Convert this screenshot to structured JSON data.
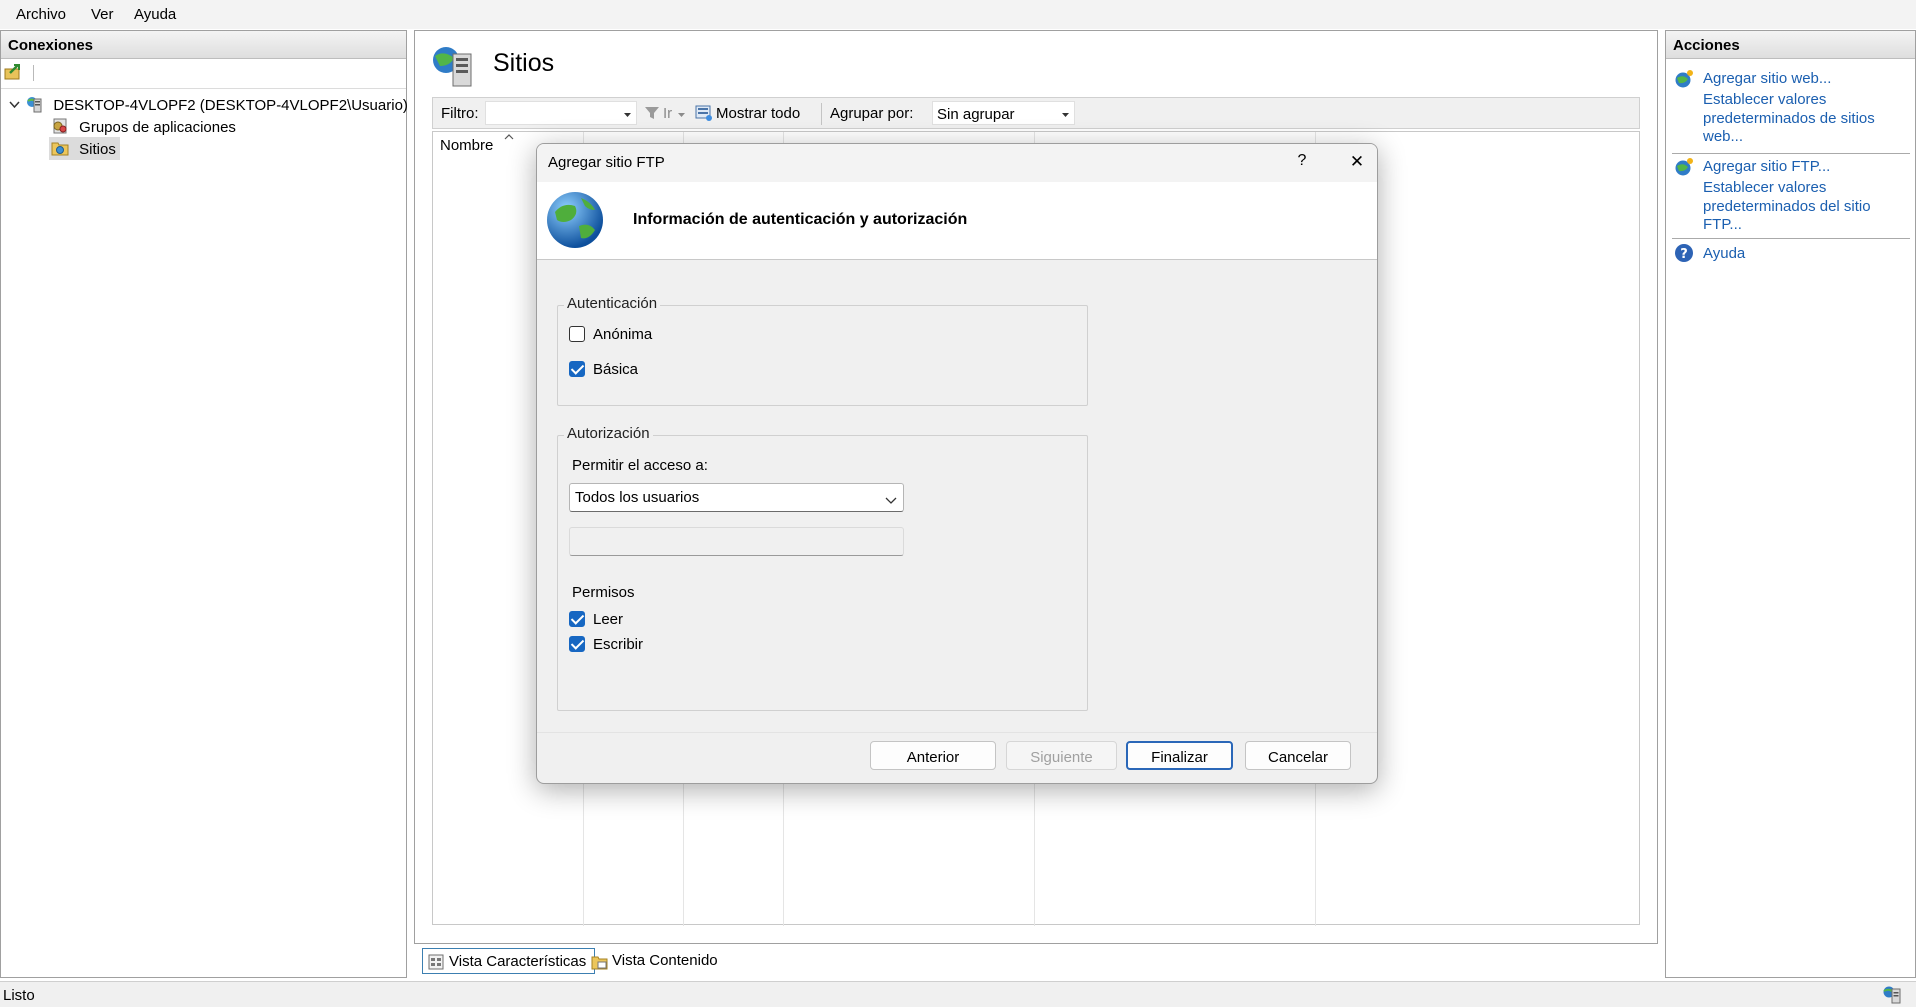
{
  "menu": [
    "Archivo",
    "Ver",
    "Ayuda"
  ],
  "connections": {
    "title": "Conexiones",
    "tree": {
      "server": "DESKTOP-4VLOPF2 (DESKTOP-4VLOPF2\\Usuario)",
      "app_pools": "Grupos de aplicaciones",
      "sites": "Sitios"
    }
  },
  "center": {
    "title": "Sitios",
    "filter_label": "Filtro:",
    "go_label": "Ir",
    "show_all_label": "Mostrar todo",
    "group_by_label": "Agrupar por:",
    "group_by_value": "Sin agrupar",
    "column_name": "Nombre"
  },
  "view_tabs": {
    "features": "Vista Características",
    "content": "Vista Contenido"
  },
  "actions": {
    "title": "Acciones",
    "add_website": "Agregar sitio web...",
    "website_defaults": "Establecer valores predeterminados de sitios web...",
    "add_ftp": "Agregar sitio FTP...",
    "ftp_defaults": "Establecer valores predeterminados del sitio FTP...",
    "help": "Ayuda"
  },
  "status": {
    "text": "Listo"
  },
  "dialog": {
    "title": "Agregar sitio FTP",
    "help_glyph": "?",
    "close_glyph": "✕",
    "header": "Información de autenticación y autorización",
    "authentication": {
      "label": "Autenticación",
      "anonymous": {
        "label": "Anónima",
        "checked": false
      },
      "basic": {
        "label": "Básica",
        "checked": true
      }
    },
    "authorization": {
      "label": "Autorización",
      "allow_access_label": "Permitir el acceso a:",
      "allow_access_value": "Todos los usuarios",
      "permissions_label": "Permisos",
      "read": {
        "label": "Leer",
        "checked": true
      },
      "write": {
        "label": "Escribir",
        "checked": true
      }
    },
    "buttons": {
      "previous": "Anterior",
      "next": "Siguiente",
      "finish": "Finalizar",
      "cancel": "Cancelar"
    }
  },
  "colors": {
    "link": "#1b5fb0",
    "accent": "#1767c2"
  }
}
